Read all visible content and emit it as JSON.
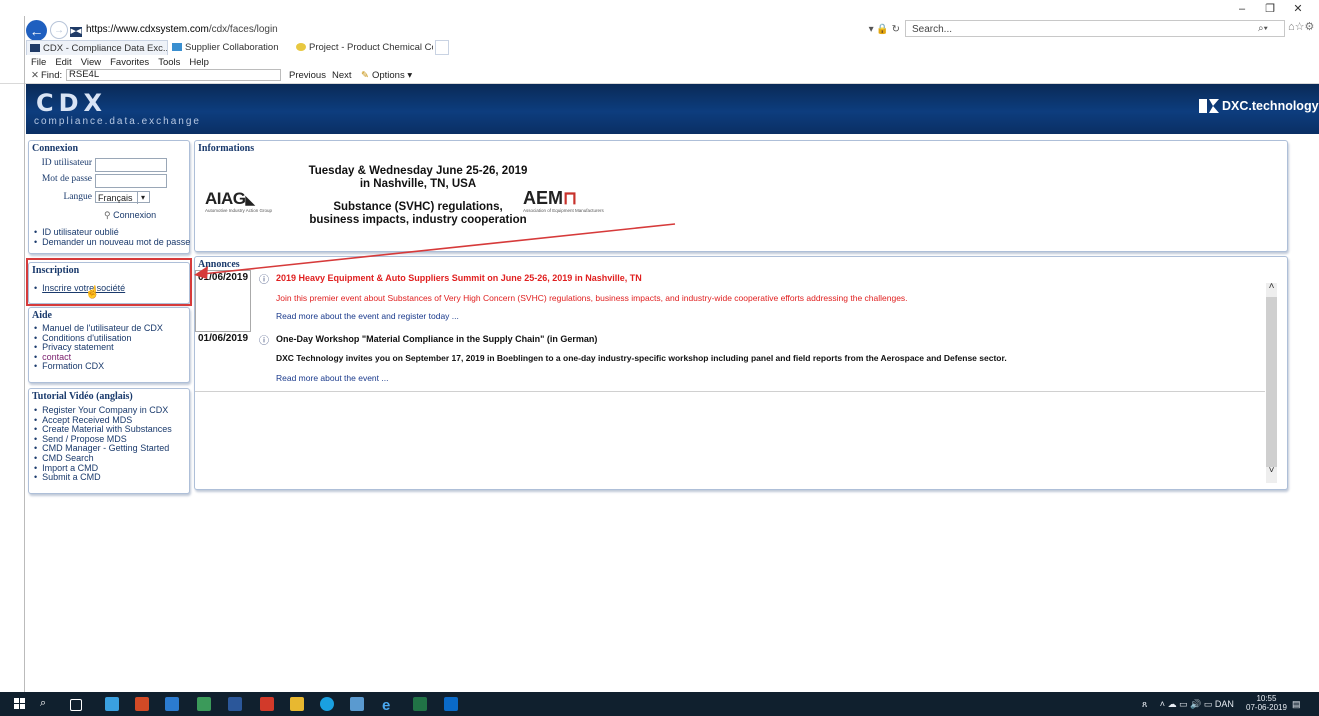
{
  "browser": {
    "url_domain": "https://www.cdxsystem.com",
    "url_path": "/cdx/faces/login",
    "search_placeholder": "Search...",
    "tabs": [
      {
        "label": "CDX - Compliance Data Exc...",
        "close": "×"
      },
      {
        "label": "Supplier Collaboration"
      },
      {
        "label": "Project - Product Chemical Co..."
      }
    ],
    "menu": [
      "File",
      "Edit",
      "View",
      "Favorites",
      "Tools",
      "Help"
    ],
    "find": {
      "label": "Find:",
      "value": "RSE4L",
      "prev": "Previous",
      "next": "Next",
      "options": "Options ▾"
    }
  },
  "header": {
    "logo_text": "CDX",
    "logo_tagline": "compliance.data.exchange",
    "brand": "DXC.technology"
  },
  "connexion": {
    "title": "Connexion",
    "user_label": "ID utilisateur",
    "password_label": "Mot de passe",
    "language_label": "Langue",
    "language_value": "Français",
    "login_button": "Connexion",
    "links": [
      "ID utilisateur oublié",
      "Demander un nouveau mot de passe"
    ]
  },
  "inscription": {
    "title": "Inscription",
    "link": "Inscrire votre société"
  },
  "aide": {
    "title": "Aide",
    "links": [
      "Manuel de l'utilisateur de CDX",
      "Conditions d'utilisation",
      "Privacy statement",
      "contact",
      "Formation CDX"
    ]
  },
  "tutorial": {
    "title": "Tutorial Vidéo (anglais)",
    "links": [
      "Register Your Company in CDX",
      "Accept Received MDS",
      "Create Material with Substances",
      "Send / Propose MDS",
      "CMD Manager - Getting Started",
      "CMD Search",
      "Import a CMD",
      "Submit a CMD"
    ]
  },
  "informations": {
    "title": "Informations",
    "banner_line1a": "Tuesday & Wednesday June 25-26, 2019",
    "banner_line1b": "in Nashville, TN, USA",
    "banner_line2a": "Substance (SVHC) regulations,",
    "banner_line2b": "business impacts, industry cooperation",
    "aiag_logo": "AIAG",
    "aiag_sub": "Automotive Industry Action Group",
    "aem_logo": "AEM",
    "aem_sub": "Association of Equipment Manufacturers"
  },
  "annonces": {
    "title": "Annonces",
    "items": [
      {
        "date": "01/06/2019",
        "title": "2019 Heavy Equipment & Auto Suppliers Summit on June 25-26, 2019 in Nashville, TN",
        "body": "Join this premier event about Substances of Very High Concern (SVHC) regulations, business impacts, and industry-wide cooperative efforts addressing the challenges.",
        "link": "Read more about the event and register today ..."
      },
      {
        "date": "01/06/2019",
        "title": "One-Day Workshop \"Material Compliance in the Supply Chain\" (in German)",
        "body": "DXC Technology invites you on September 17, 2019 in Boeblingen to a one-day industry-specific workshop including panel and field reports from the Aerospace and Defense sector.",
        "link": "Read more about the event ..."
      }
    ]
  },
  "taskbar": {
    "tray_lang": "DAN",
    "time": "10:55",
    "date": "07-06-2019"
  },
  "colors": {
    "header_blue": "#0d3d7e",
    "link_blue": "#1a3a6c",
    "alert_red": "#d63a3a",
    "announcement_red": "#e02020"
  }
}
